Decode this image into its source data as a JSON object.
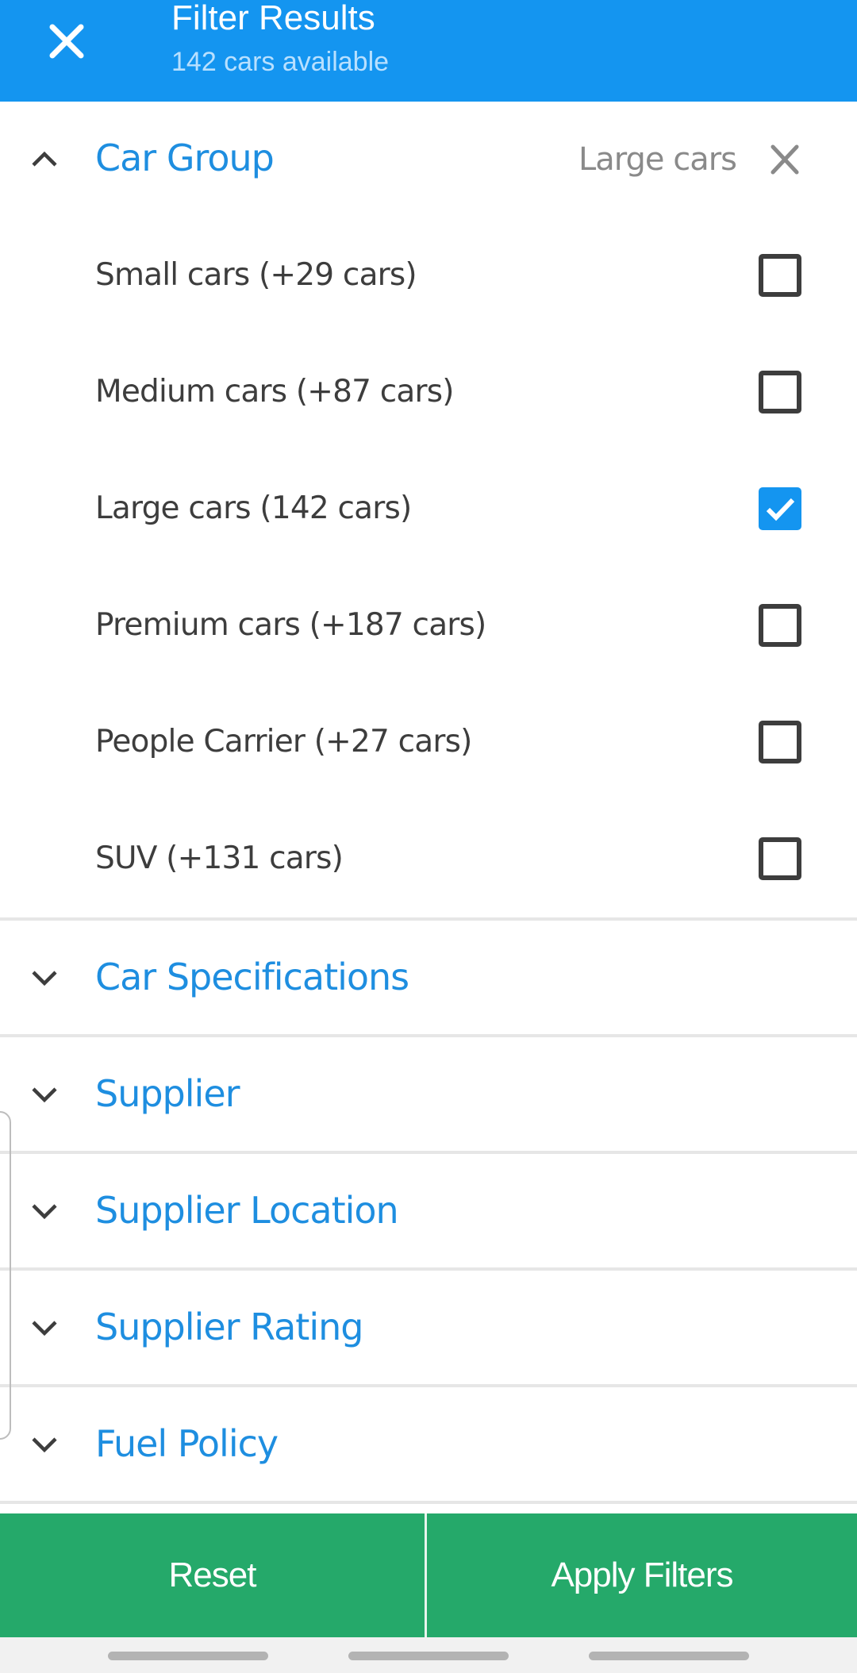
{
  "header": {
    "title": "Filter Results",
    "subtitle": "142 cars available",
    "close_icon": "close-icon",
    "background_color": "#1495f0"
  },
  "car_group": {
    "title": "Car Group",
    "expanded": true,
    "selected_value": "Large cars",
    "options": [
      {
        "label": "Small cars (+29 cars)",
        "checked": false
      },
      {
        "label": "Medium cars (+87 cars)",
        "checked": false
      },
      {
        "label": "Large cars (142 cars)",
        "checked": true
      },
      {
        "label": "Premium cars (+187 cars)",
        "checked": false
      },
      {
        "label": "People Carrier (+27 cars)",
        "checked": false
      },
      {
        "label": "SUV (+131 cars)",
        "checked": false
      }
    ]
  },
  "sections": [
    {
      "title": "Car Specifications",
      "expanded": false
    },
    {
      "title": "Supplier",
      "expanded": false
    },
    {
      "title": "Supplier Location",
      "expanded": false
    },
    {
      "title": "Supplier Rating",
      "expanded": false
    },
    {
      "title": "Fuel Policy",
      "expanded": false
    }
  ],
  "footer": {
    "reset_label": "Reset",
    "apply_label": "Apply Filters",
    "button_color": "#25a96a"
  },
  "colors": {
    "accent": "#1e8ee0",
    "checkbox_checked": "#1495f0",
    "text": "#3d3d3d"
  }
}
